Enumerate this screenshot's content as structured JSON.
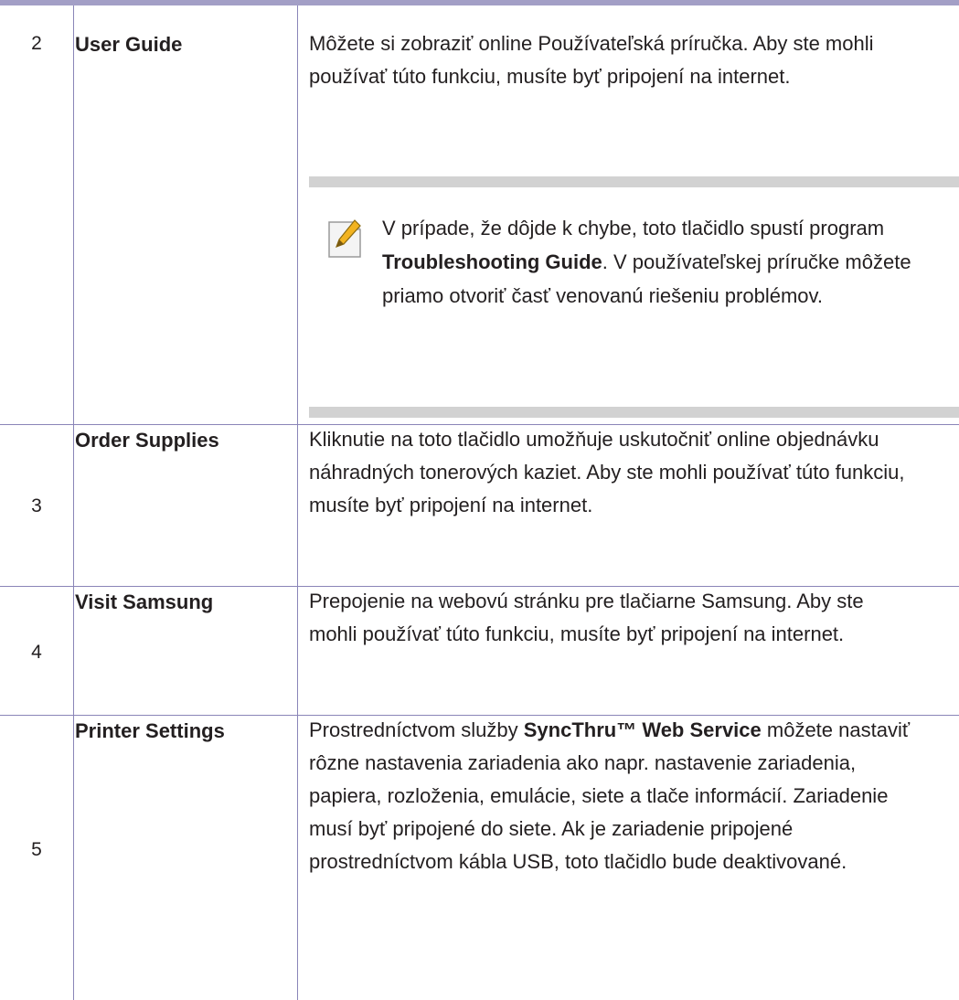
{
  "rows": [
    {
      "number": "2",
      "label": "User Guide",
      "description": "Môžete si zobraziť online Používateľská príručka. Aby ste mohli používať túto funkciu, musíte byť pripojení na internet.",
      "note": {
        "icon": "note-pencil-icon",
        "text_before": "V prípade, že dôjde k chybe, toto tlačidlo spustí program ",
        "text_bold": "Troubleshooting Guide",
        "text_after": ". V používateľskej príručke môžete priamo otvoriť časť venovanú riešeniu problémov."
      }
    },
    {
      "number": "3",
      "label": "Order Supplies",
      "description": "Kliknutie na toto tlačidlo umožňuje uskutočniť online objednávku náhradných tonerových kaziet. Aby ste mohli používať túto funkciu, musíte byť pripojení na internet."
    },
    {
      "number": "4",
      "label": "Visit Samsung",
      "description": "Prepojenie na webovú stránku pre tlačiarne Samsung. Aby ste mohli používať túto funkciu, musíte byť pripojení na internet."
    },
    {
      "number": "5",
      "label": "Printer Settings",
      "description_before": "Prostredníctvom služby ",
      "description_bold": "SyncThru™ Web Service",
      "description_after": " môžete nastaviť rôzne nastavenia zariadenia ako napr. nastavenie zariadenia, papiera, rozloženia, emulácie, siete a tlače informácií. Zariadenie musí byť pripojené do siete. Ak je zariadenie pripojené prostredníctvom kábla USB, toto tlačidlo bude deaktivované."
    }
  ],
  "colors": {
    "rule": "#a39fc6",
    "grid": "#8a85b8",
    "note_bar": "#d2d2d2",
    "text": "#231f20"
  }
}
